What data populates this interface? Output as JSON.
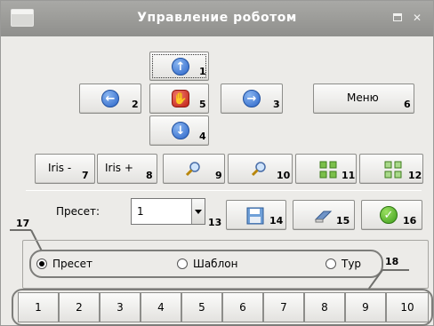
{
  "window": {
    "title": "Управление роботом",
    "max_glyph": "□",
    "close_glyph": "✕"
  },
  "dpad": {
    "up": {
      "num": "1",
      "icon": "arrow-up-icon"
    },
    "left": {
      "num": "2",
      "icon": "arrow-left-icon"
    },
    "stop": {
      "num": "5",
      "icon": "stop-hand-icon"
    },
    "right": {
      "num": "3",
      "icon": "arrow-right-icon"
    },
    "down": {
      "num": "4",
      "icon": "arrow-down-icon"
    }
  },
  "menu": {
    "label": "Меню",
    "num": "6"
  },
  "iris_minus": {
    "label": "Iris -",
    "num": "7"
  },
  "iris_plus": {
    "label": "Iris +",
    "num": "8"
  },
  "zoom_in": {
    "num": "9",
    "icon": "magnifier-icon"
  },
  "zoom_out": {
    "num": "10",
    "icon": "magnifier-icon"
  },
  "focus_near": {
    "num": "11",
    "icon": "focus-grid-icon"
  },
  "focus_far": {
    "num": "12",
    "icon": "focus-grid-icon"
  },
  "preset": {
    "label": "Пресет:",
    "value": "1",
    "num": "13",
    "save_num": "14",
    "erase_num": "15",
    "ok_num": "16"
  },
  "annotations": {
    "a17": "17",
    "a18": "18"
  },
  "mode": {
    "options": [
      {
        "label": "Пресет",
        "checked": true
      },
      {
        "label": "Шаблон",
        "checked": false
      },
      {
        "label": "Тур",
        "checked": false
      }
    ]
  },
  "numbers": [
    "1",
    "2",
    "3",
    "4",
    "5",
    "6",
    "7",
    "8",
    "9",
    "10"
  ],
  "colors": {
    "accent_blue": "#2a64c8",
    "stop_red": "#c01f14",
    "ok_green": "#3c9d1a",
    "titlebar": "#9a9a97"
  }
}
